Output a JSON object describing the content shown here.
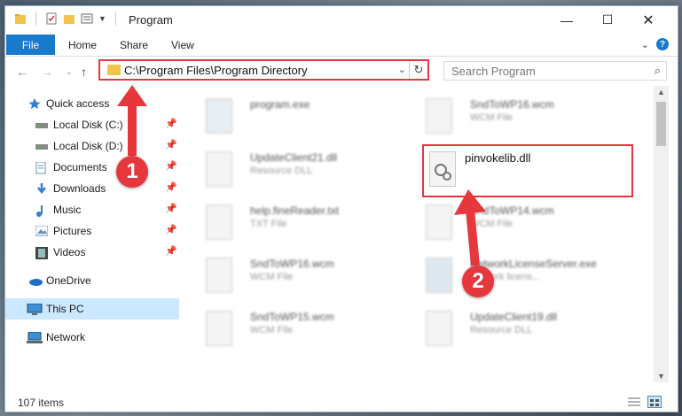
{
  "window": {
    "title": "Program"
  },
  "ribbon": {
    "file": "File",
    "home": "Home",
    "share": "Share",
    "view": "View"
  },
  "address": {
    "path": "C:\\Program Files\\Program Directory"
  },
  "search": {
    "placeholder": "Search Program"
  },
  "sidebar": {
    "items": [
      {
        "label": "Quick access",
        "icon": "star-icon"
      },
      {
        "label": "Local Disk (C:)",
        "icon": "drive-icon",
        "pinned": true
      },
      {
        "label": "Local Disk (D:)",
        "icon": "drive-icon",
        "pinned": true
      },
      {
        "label": "Documents",
        "icon": "documents-icon",
        "pinned": true
      },
      {
        "label": "Downloads",
        "icon": "download-icon",
        "pinned": true
      },
      {
        "label": "Music",
        "icon": "music-icon",
        "pinned": true
      },
      {
        "label": "Pictures",
        "icon": "pictures-icon",
        "pinned": true
      },
      {
        "label": "Videos",
        "icon": "videos-icon",
        "pinned": true
      },
      {
        "label": "OneDrive",
        "icon": "cloud-icon"
      },
      {
        "label": "This PC",
        "icon": "computer-icon",
        "selected": true
      },
      {
        "label": "Network",
        "icon": "network-icon"
      }
    ]
  },
  "files": [
    {
      "name": "program.exe",
      "type": ""
    },
    {
      "name": "SndToWP16.wcm",
      "type": "WCM File"
    },
    {
      "name": "UpdateClient21.dll",
      "type": "Resource DLL"
    },
    {
      "name": "pinvokelib.dll",
      "type": ""
    },
    {
      "name": "help.fineReader.txt",
      "type": "TXT File"
    },
    {
      "name": "SndToWP14.wcm",
      "type": "WCM File"
    },
    {
      "name": "SndToWP16.wcm",
      "type": "WCM File"
    },
    {
      "name": "NetworkLicenseServer.exe",
      "type": "network licens..."
    },
    {
      "name": "SndToWP15.wcm",
      "type": "WCM File"
    },
    {
      "name": "UpdateClient19.dll",
      "type": "Resource DLL"
    }
  ],
  "status": {
    "count": "107 items"
  },
  "annotations": {
    "badge1": "1",
    "badge2": "2"
  },
  "colors": {
    "accent": "#1979ca",
    "highlight": "#e5373c",
    "selected_bg": "#cce8ff"
  }
}
